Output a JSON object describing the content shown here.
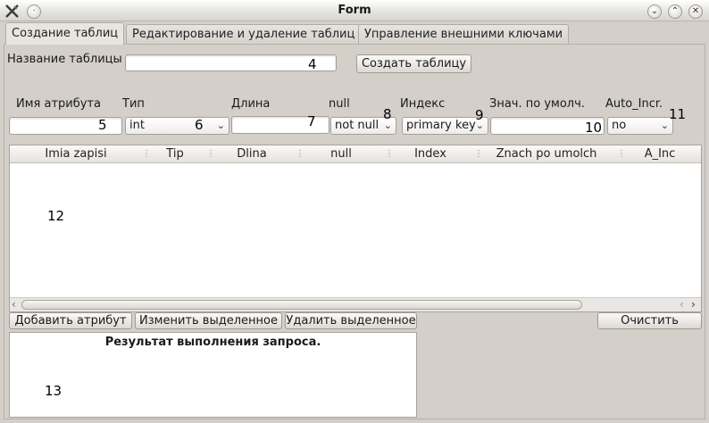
{
  "window": {
    "title": "Form"
  },
  "tabs": [
    {
      "label": "Создание таблиц"
    },
    {
      "label": "Редактирование и удаление таблиц"
    },
    {
      "label": "Управление внешними ключами"
    }
  ],
  "table_name": {
    "label": "Название таблицы",
    "value": "",
    "create_button": "Создать таблицу"
  },
  "attribute_form": {
    "name_label": "Имя атрибута",
    "type_label": "Тип",
    "type_value": "int",
    "length_label": "Длина",
    "null_label": "null",
    "null_value": "not null",
    "index_label": "Индекс",
    "index_value": "primary key",
    "default_label": "Знач. по умолч.",
    "autoinc_label": "Auto_Incr.",
    "autoinc_value": "no"
  },
  "markers": {
    "m4": "4",
    "m5": "5",
    "m6": "6",
    "m7": "7",
    "m8": "8",
    "m9": "9",
    "m10": "10",
    "m11": "11",
    "m12": "12",
    "m13": "13"
  },
  "table": {
    "columns": [
      "Imia zapisi",
      "Tip",
      "Dlina",
      "null",
      "Index",
      "Znach po umolch",
      "A_Inc"
    ]
  },
  "actions": {
    "add": "Добавить атрибут",
    "edit": "Изменить выделенное",
    "delete": "Удалить выделенное",
    "clear": "Очистить"
  },
  "result": {
    "title": "Результат выполнения запроса."
  },
  "icons": {
    "app": "app-logo-icon",
    "pin": "pin-icon",
    "minimize": "minimize-icon",
    "maximize": "maximize-icon",
    "close": "close-icon"
  }
}
